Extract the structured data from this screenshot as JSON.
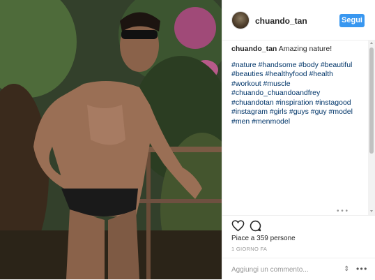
{
  "post": {
    "username": "chuando_tan",
    "follow_label": "Segui",
    "caption_author": "chuando_tan",
    "caption_text": "Amazing nature!",
    "hashtags": "#nature #handsome #body #beautiful #beauties #healthyfood #health #workout #muscle #chuando_chuandoandfrey #chuandotan #inspiration #instagood #instagram #girls #guys #guy #model #men #menmodel",
    "likes_text": "Piace a 359 persone",
    "time_text": "1 GIORNO FA",
    "comment_placeholder": "Aggiungi un commento...",
    "more_dots": "• • •",
    "scroll_dots": "• • •"
  },
  "icons": {
    "heart": "heart-icon",
    "comment": "comment-icon",
    "sort": "sort-arrows-icon",
    "more": "more-options-icon"
  },
  "colors": {
    "follow_button": "#3897f0",
    "hashtag": "#003569",
    "text": "#262626",
    "muted": "#999999"
  }
}
